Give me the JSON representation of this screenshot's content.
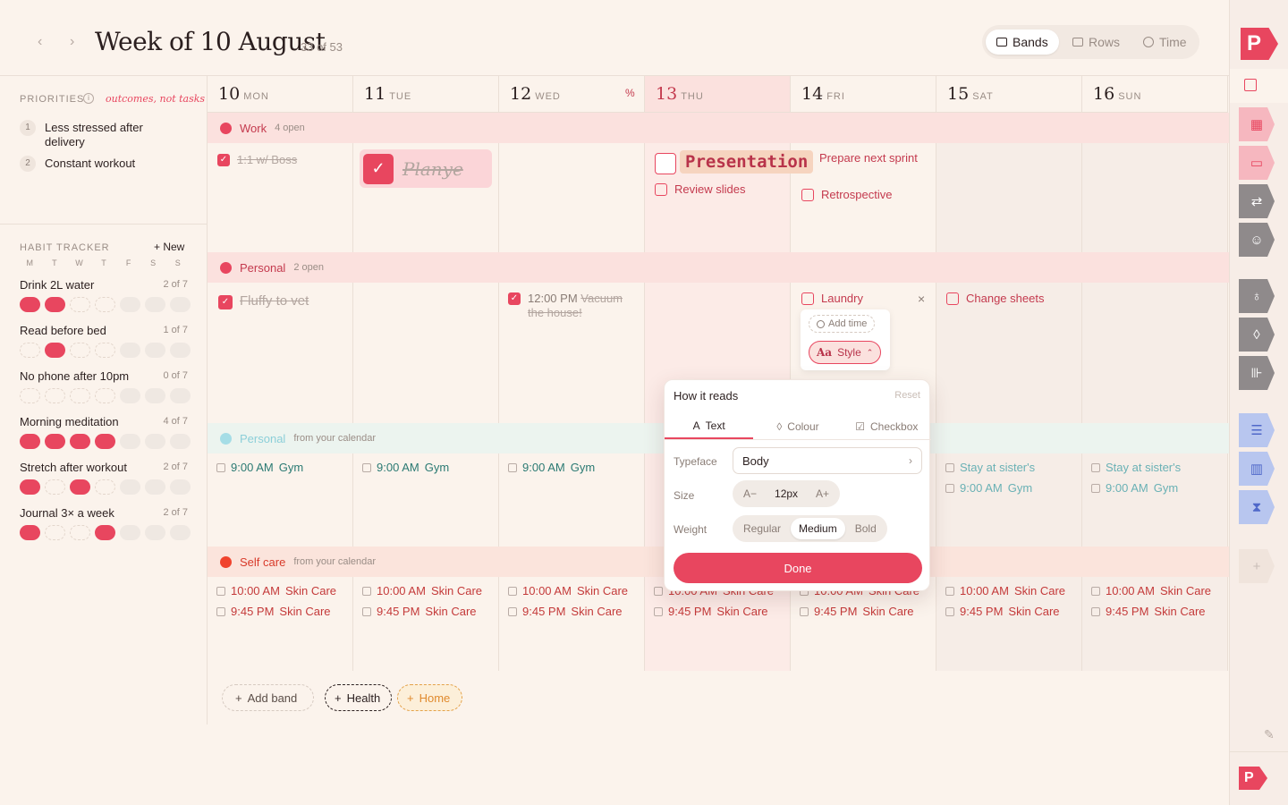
{
  "header": {
    "prev": "‹",
    "next": "›",
    "title": "Week of 10 August",
    "count": "33 of 53",
    "views": [
      {
        "label": "Bands"
      },
      {
        "label": "Rows"
      },
      {
        "label": "Time"
      }
    ]
  },
  "priorities": {
    "label": "PRIORITIES",
    "hint": "outcomes, not tasks",
    "items": [
      {
        "n": "1",
        "text": "Less stressed after delivery"
      },
      {
        "n": "2",
        "text": "Constant workout"
      }
    ]
  },
  "habits": {
    "label": "HABIT TRACKER",
    "new_label": "+ New",
    "days": [
      "M",
      "T",
      "W",
      "T",
      "F",
      "S",
      "S"
    ],
    "items": [
      {
        "name": "Drink 2L water",
        "count": "2 of 7",
        "done": [
          1,
          1,
          0,
          0,
          0,
          0,
          0
        ]
      },
      {
        "name": "Read before bed",
        "count": "1 of 7",
        "done": [
          0,
          1,
          0,
          0,
          0,
          0,
          0
        ]
      },
      {
        "name": "No phone after 10pm",
        "count": "0 of 7",
        "done": [
          0,
          0,
          0,
          0,
          0,
          0,
          0
        ]
      },
      {
        "name": "Morning meditation",
        "count": "4 of 7",
        "done": [
          1,
          1,
          1,
          1,
          0,
          0,
          0
        ]
      },
      {
        "name": "Stretch after workout",
        "count": "2 of 7",
        "done": [
          1,
          0,
          1,
          0,
          0,
          0,
          0
        ]
      },
      {
        "name": "Journal 3× a week",
        "count": "2 of 7",
        "done": [
          1,
          0,
          0,
          1,
          0,
          0,
          0
        ]
      }
    ]
  },
  "days": [
    {
      "num": "10",
      "name": "MON"
    },
    {
      "num": "11",
      "name": "TUE"
    },
    {
      "num": "12",
      "name": "WED"
    },
    {
      "num": "13",
      "name": "THU"
    },
    {
      "num": "14",
      "name": "FRI"
    },
    {
      "num": "15",
      "name": "SAT"
    },
    {
      "num": "16",
      "name": "SUN"
    }
  ],
  "bands": {
    "work": {
      "name": "Work",
      "sub": "4 open",
      "color": "#e8465f"
    },
    "personal": {
      "name": "Personal",
      "sub": "2 open",
      "color": "#e8465f"
    },
    "personal_cal": {
      "name": "Personal",
      "sub": "from your calendar",
      "color": "#a5dde6"
    },
    "selfcare": {
      "name": "Self care",
      "sub": "from your calendar",
      "color": "#f0442e"
    }
  },
  "work_tasks": {
    "mon": "1:1 w/ Boss",
    "tue": "Planye",
    "thu1": "Presentation",
    "thu2": "Review slides",
    "fri1": "Prepare next sprint",
    "fri2": "Retrospective"
  },
  "personal_tasks": {
    "mon": "Fluffy to vet",
    "wed_time": "12:00 PM",
    "wed": "Vacuum the house!",
    "fri": "Laundry",
    "sat": "Change sheets",
    "add_time": "Add time",
    "style": "Style",
    "close": "×"
  },
  "cal_events": {
    "gym_time": "9:00 AM",
    "gym": "Gym",
    "sister": "Stay at sister's"
  },
  "selfcare_events": {
    "am_time": "10:00 AM",
    "pm_time": "9:45 PM",
    "label": "Skin Care"
  },
  "popover": {
    "title": "How it reads",
    "reset": "Reset",
    "tabs": [
      {
        "label": "Text"
      },
      {
        "label": "Colour"
      },
      {
        "label": "Checkbox"
      }
    ],
    "typeface_label": "Typeface",
    "typeface": "Body",
    "size_label": "Size",
    "size_dec": "A−",
    "size": "12px",
    "size_inc": "A+",
    "weight_label": "Weight",
    "weights": [
      "Regular",
      "Medium",
      "Bold"
    ],
    "done": "Done"
  },
  "bottom": {
    "add_band": "Add band",
    "health": "Health",
    "home": "Home"
  },
  "colors": {
    "accent": "#e8465f",
    "rail_pink": "#f6b7bf",
    "rail_gray": "#8f8a8b",
    "rail_blue": "#b8c6ef"
  }
}
